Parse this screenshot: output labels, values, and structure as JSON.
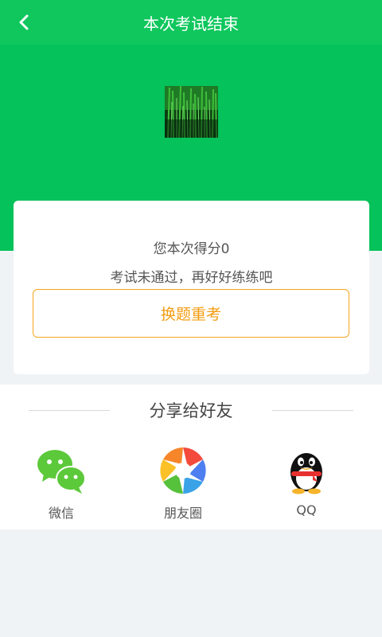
{
  "header": {
    "title": "本次考试结束"
  },
  "result": {
    "score_text": "您本次得分0",
    "message": "考试未通过，再好好练练吧",
    "retry_label": "换题重考"
  },
  "share": {
    "title": "分享给好友",
    "items": [
      {
        "label": "微信",
        "icon": "wechat-icon"
      },
      {
        "label": "朋友圈",
        "icon": "moments-icon"
      },
      {
        "label": "QQ",
        "icon": "qq-icon"
      }
    ]
  },
  "colors": {
    "topbar": "#0fc75d",
    "hero": "#05c25a",
    "accent": "#f39c12",
    "background": "#f0f3f6"
  }
}
